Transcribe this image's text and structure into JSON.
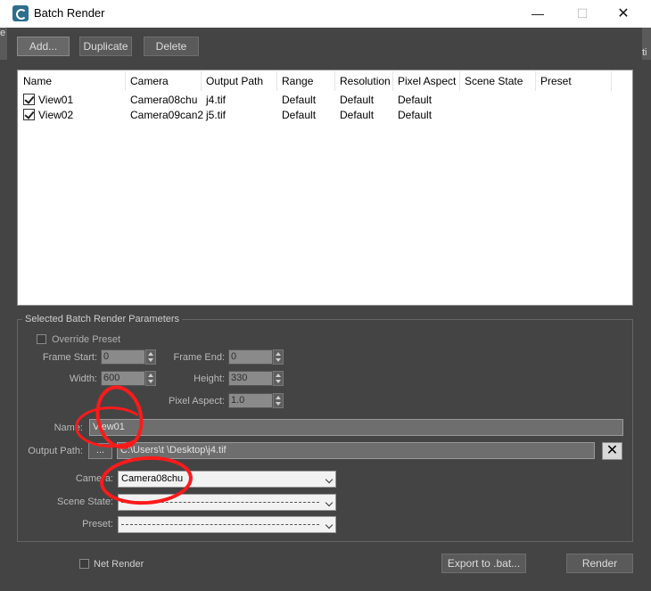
{
  "window": {
    "title": "Batch Render"
  },
  "left_strip": "e",
  "right_strip": "ti",
  "toolbar": {
    "add_label": "Add...",
    "duplicate_label": "Duplicate",
    "delete_label": "Delete"
  },
  "list": {
    "columns": [
      "Name",
      "Camera",
      "Output Path",
      "Range",
      "Resolution",
      "Pixel Aspect",
      "Scene State",
      "Preset"
    ],
    "rows": [
      {
        "name": "View01",
        "camera": "Camera08chu",
        "output": "j4.tif",
        "range": "Default",
        "resolution": "Default",
        "pixel_aspect": "Default",
        "checked": true
      },
      {
        "name": "View02",
        "camera": "Camera09can2",
        "output": "j5.tif",
        "range": "Default",
        "resolution": "Default",
        "pixel_aspect": "Default",
        "checked": true
      }
    ]
  },
  "params": {
    "group_title": "Selected Batch Render Parameters",
    "override_preset": "Override Preset",
    "frame_start_label": "Frame Start:",
    "frame_start": "0",
    "frame_end_label": "Frame End:",
    "frame_end": "0",
    "width_label": "Width:",
    "width": "600",
    "height_label": "Height:",
    "height": "330",
    "pixel_aspect_label": "Pixel Aspect:",
    "pixel_aspect": "1.0",
    "name_label": "Name:",
    "name_value": "View01",
    "output_path_label": "Output Path:",
    "browse_label": "...",
    "output_path_value": "C:\\Users\\t  \\Desktop\\j4.tif",
    "camera_label": "Camera:",
    "camera_value": "Camera08chu",
    "scene_state_label": "Scene State:",
    "preset_label": "Preset:"
  },
  "bottom": {
    "net_render": "Net Render",
    "export_label": "Export to .bat...",
    "render_label": "Render"
  },
  "colors": {
    "background": "#444444",
    "annotation": "#ff1a1a"
  }
}
